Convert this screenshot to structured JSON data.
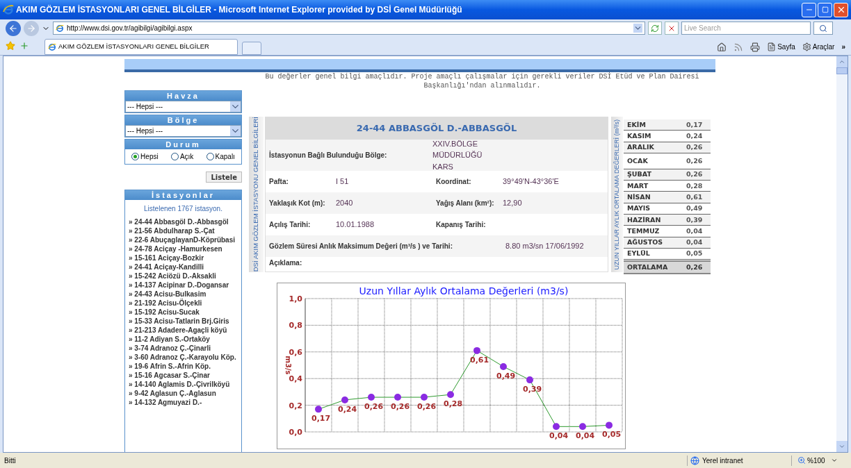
{
  "window": {
    "title": "AKIM GÖZLEM İSTASYONLARI GENEL BİLGİLER - Microsoft Internet Explorer provided by DSİ Genel Müdürlüğü"
  },
  "address_bar": {
    "url": "http://www.dsi.gov.tr/agibilgi/agibilgi.aspx",
    "search_placeholder": "Live Search"
  },
  "tabs": [
    {
      "label": "AKIM GÖZLEM İSTASYONLARI GENEL BİLGİLER",
      "selected": true
    }
  ],
  "command_bar": {
    "items": [
      "Sayfa",
      "Araçlar"
    ],
    "more": "»"
  },
  "page": {
    "notice": "Bu değerler genel bilgi amaçlıdır. Proje amaçlı çalışmalar için gerekli veriler DSİ Etüd ve Plan Dairesi Başkanlığı'ndan alınmalıdır.",
    "filters": [
      {
        "label": "Havza",
        "kind": "select",
        "value": "--- Hepsi ---"
      },
      {
        "label": "Bölge",
        "kind": "select",
        "value": "--- Hepsi ---"
      },
      {
        "label": "Durum",
        "kind": "radio",
        "options": [
          {
            "label": "Hepsi",
            "selected": true
          },
          {
            "label": "Açık",
            "selected": false
          },
          {
            "label": "Kapalı",
            "selected": false
          }
        ]
      }
    ],
    "list_button": "Listele",
    "stations": {
      "title": "İstasyonlar",
      "count": "Listelenen 1767 istasyon.",
      "items": [
        "» 24-44 Abbasgöl D.-Abbasgöl",
        "» 21-56 Abdulharap S.-Çat",
        "» 22-6 AbuçaglayanD-Köprübasi",
        "» 24-78 Aciçay -Hamurkesen",
        "» 15-161 Aciçay-Bozkir",
        "» 24-41 Aciçay-Kandilli",
        "» 15-242 Aciözü D.-Aksakli",
        "» 14-137 Acipinar D.-Dogansar",
        "» 24-43 Acisu-Bulkasim",
        "» 21-192 Acisu-Ölçekli",
        "» 15-192 Acisu-Sucak",
        "» 15-33 Acisu-Tatlarin Brj.Giris",
        "» 21-213 Adadere-Agaçli köyü",
        "» 11-2 Adiyan S.-Ortaköy",
        "» 3-74 Adranoz Ç.-Çinarli",
        "» 3-60 Adranoz Ç.-Karayolu Köp.",
        "» 19-6 Afrin S.-Afrin Köp.",
        "» 15-16 Agcasar S.-Çinar",
        "» 14-140 Aglamis D.-Çivrilköyü",
        "» 9-42 Aglasun Ç.-Aglasun",
        "» 14-132 Agmuyazi D.-"
      ]
    },
    "info": {
      "side_label": "DSİ AKIM GÖZLEM İSTASYONU GENEL BİLGİLERİ",
      "title": "24-44 ABBASGÖL D.-ABBASGÖL",
      "rows": [
        [
          {
            "label": "İstasyonun Bağlı Bulunduğu Bölge:",
            "value": "XXIV.BÖLGE MÜDÜRLÜĞÜ KARS"
          }
        ],
        [
          {
            "label": "Pafta:",
            "value": "I 51"
          },
          {
            "label": "Koordinat:",
            "value": "39°49'N-43°36'E"
          }
        ],
        [
          {
            "label": "Yaklaşık Kot (m):",
            "value": "2040"
          },
          {
            "label": "Yağış Alanı (km²):",
            "value": "12,90"
          }
        ],
        [
          {
            "label": "Açılış Tarihi:",
            "value": "10.01.1988"
          },
          {
            "label": "Kapanış Tarihi:"
          }
        ],
        [
          {
            "label": "Gözlem Süresi Anlık Maksimum Değeri (m³/s ) ve Tarihi:",
            "value": "8.80 m3/sn 17/06/1992"
          }
        ],
        [
          {
            "label": "Açıklama:"
          }
        ]
      ]
    },
    "monthly": {
      "side_label": "UZUN YILLAR AYLIK ORTALAMA DEĞERLERİ (m³/s)",
      "rows": [
        [
          "EKİM",
          "0,17"
        ],
        [
          "KASIM",
          "0,24"
        ],
        [
          "ARALIK",
          "0,26"
        ],
        [
          "OCAK",
          "0,26"
        ],
        [
          "ŞUBAT",
          "0,26"
        ],
        [
          "MART",
          "0,28"
        ],
        [
          "NİSAN",
          "0,61"
        ],
        [
          "MAYIS",
          "0,49"
        ],
        [
          "HAZİRAN",
          "0,39"
        ],
        [
          "TEMMUZ",
          "0,04"
        ],
        [
          "AĞUSTOS",
          "0,04"
        ],
        [
          "EYLÜL",
          "0,05"
        ]
      ],
      "total": [
        "ORTALAMA",
        "0,26"
      ]
    },
    "chart_data": {
      "type": "line",
      "title": "Uzun Yıllar Aylık Ortalama Değerleri (m3/s)",
      "ylabel": "m3/s",
      "ylim": [
        0,
        1
      ],
      "yticks": [
        {
          "value": 0,
          "label": "0,0"
        },
        {
          "value": 0.2,
          "label": "0,2"
        },
        {
          "value": 0.4,
          "label": "0,4"
        },
        {
          "value": 0.6,
          "label": "0,6"
        },
        {
          "value": 0.8,
          "label": "0,8"
        },
        {
          "value": 1,
          "label": "1,0"
        }
      ],
      "grid": true,
      "series": [
        {
          "color": "#2e9a2e",
          "marker": "circle",
          "values": [
            0.17,
            0.24,
            0.26,
            0.26,
            0.26,
            0.28,
            0.61,
            0.49,
            0.39,
            0.04,
            0.04,
            0.05
          ]
        }
      ],
      "value_labels": [
        "0,17",
        "0,24",
        "0,26",
        "0,26",
        "0,26",
        "0,28",
        "0,61",
        "0,49",
        "0,39",
        "0,04",
        "0,04",
        "0,05"
      ]
    }
  },
  "status_bar": {
    "text": "Bitti",
    "zone": "Yerel intranet",
    "zoom": "%100"
  }
}
